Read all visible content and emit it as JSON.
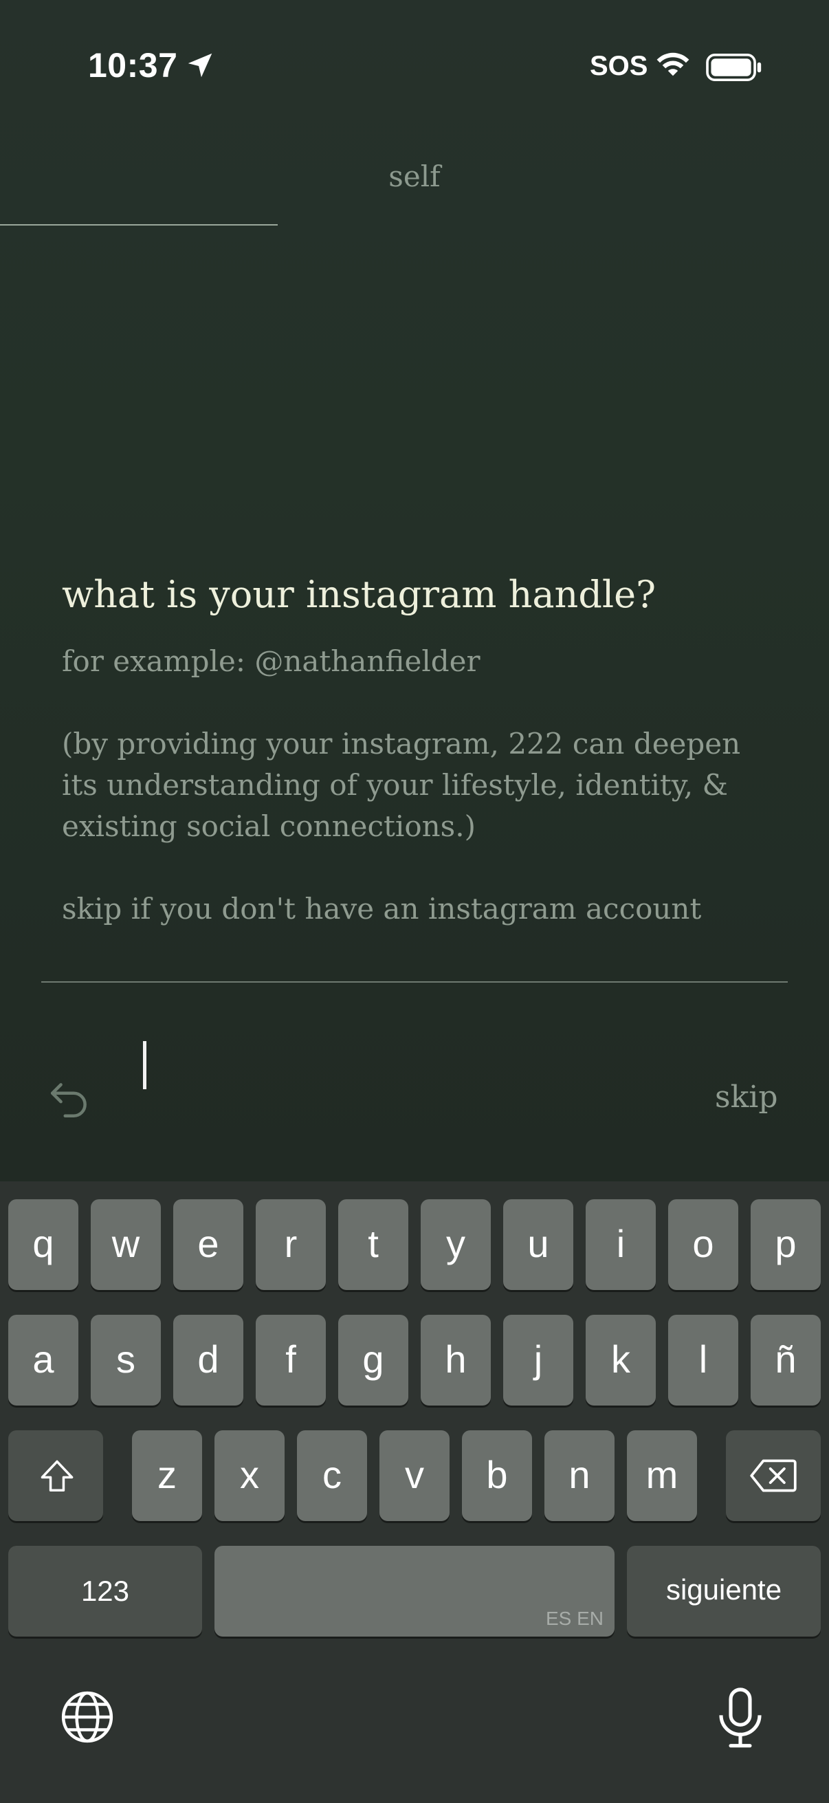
{
  "status_bar": {
    "time": "10:37",
    "sos": "SOS"
  },
  "nav": {
    "title": "self",
    "progress": 0.335
  },
  "question": {
    "title": "what is your instagram handle?",
    "example": "for example: @nathanfielder",
    "explanation_line1": "(by providing your instagram, 222 can deepen",
    "explanation_line2": "its understanding of your lifestyle, identity, &",
    "explanation_line3": "existing social connections.)",
    "skip_note": "skip if you don't have an instagram account"
  },
  "input": {
    "value": ""
  },
  "actions": {
    "skip_label": "skip",
    "undo_icon": "undo-icon"
  },
  "keyboard": {
    "row1": [
      "q",
      "w",
      "e",
      "r",
      "t",
      "y",
      "u",
      "i",
      "o",
      "p"
    ],
    "row2": [
      "a",
      "s",
      "d",
      "f",
      "g",
      "h",
      "j",
      "k",
      "l",
      "ñ"
    ],
    "row3": [
      "z",
      "x",
      "c",
      "v",
      "b",
      "n",
      "m"
    ],
    "numbers_label": "123",
    "space_lang": "ES EN",
    "return_label": "siguiente",
    "shift_icon": "shift-icon",
    "delete_icon": "delete-icon",
    "globe_icon": "globe-icon",
    "mic_icon": "microphone-icon"
  }
}
